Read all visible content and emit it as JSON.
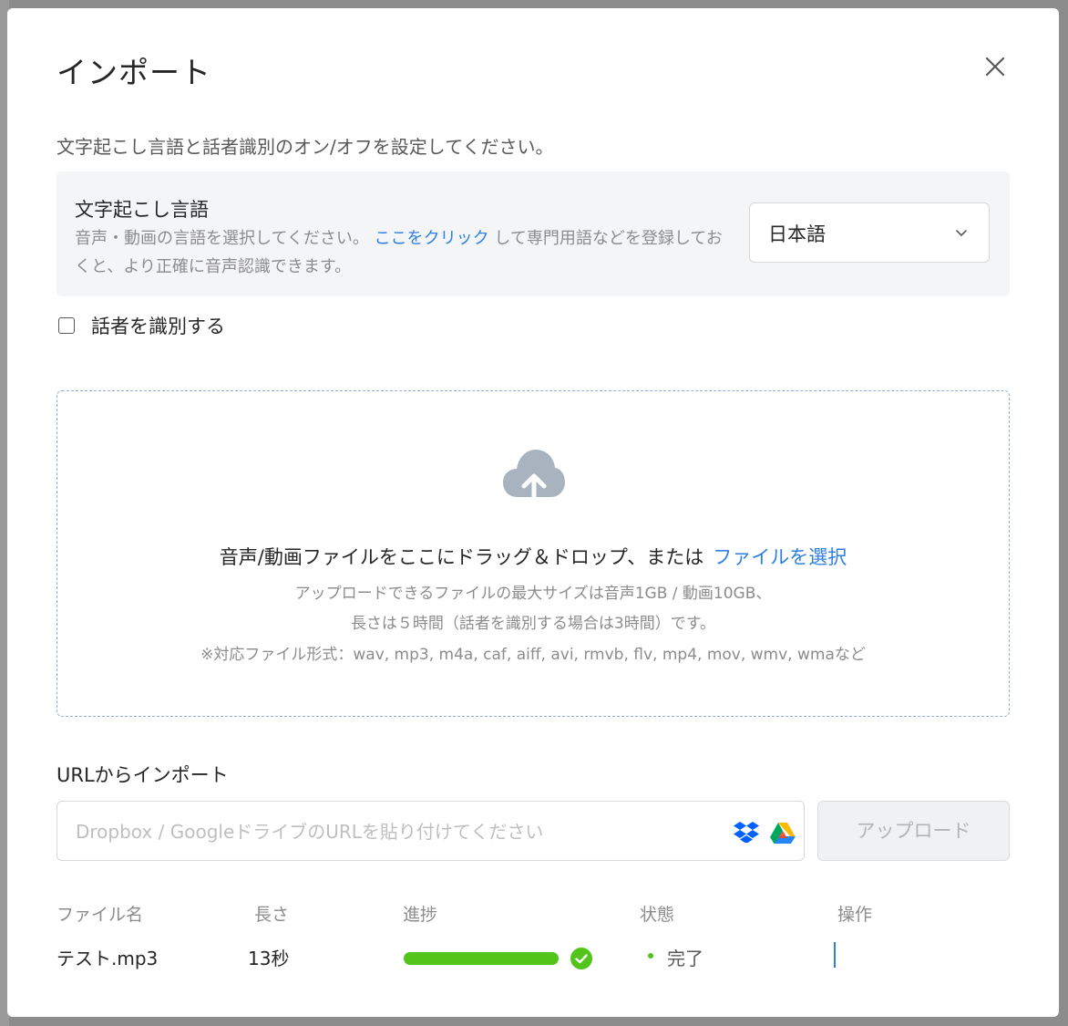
{
  "dialog": {
    "title": "インポート",
    "subtitle": "文字起こし言語と話者識別のオン/オフを設定してください。"
  },
  "language": {
    "title": "文字起こし言語",
    "desc_before": "音声・動画の言語を選択してください。",
    "desc_link": "ここをクリック",
    "desc_after": "して専門用語などを登録しておくと、より正確に音声認識できます。",
    "selected": "日本語"
  },
  "speaker": {
    "label": "話者を識別する",
    "checked": false
  },
  "dropzone": {
    "main": "音声/動画ファイルをここにドラッグ＆ドロップ、または",
    "link": "ファイルを選択",
    "line1": "アップロードできるファイルの最大サイズは音声1GB / 動画10GB、",
    "line2": "長さは５時間（話者を識別する場合は3時間）です。",
    "line3": "※対応ファイル形式：wav, mp3, m4a, caf, aiff, avi, rmvb, flv, mp4, mov, wmv, wmaなど"
  },
  "url_import": {
    "title": "URLからインポート",
    "placeholder": "Dropbox / GoogleドライブのURLを貼り付けてください",
    "value": "",
    "upload_label": "アップロード"
  },
  "table": {
    "headers": [
      "ファイル名",
      "長さ",
      "進捗",
      "状態",
      "操作"
    ],
    "rows": [
      {
        "name": "テスト.mp3",
        "length": "13秒",
        "progress": 1.0,
        "status": "完了",
        "status_color": "#52c41a"
      }
    ]
  },
  "colors": {
    "accent": "#2f7fe0",
    "success": "#52c41a"
  }
}
